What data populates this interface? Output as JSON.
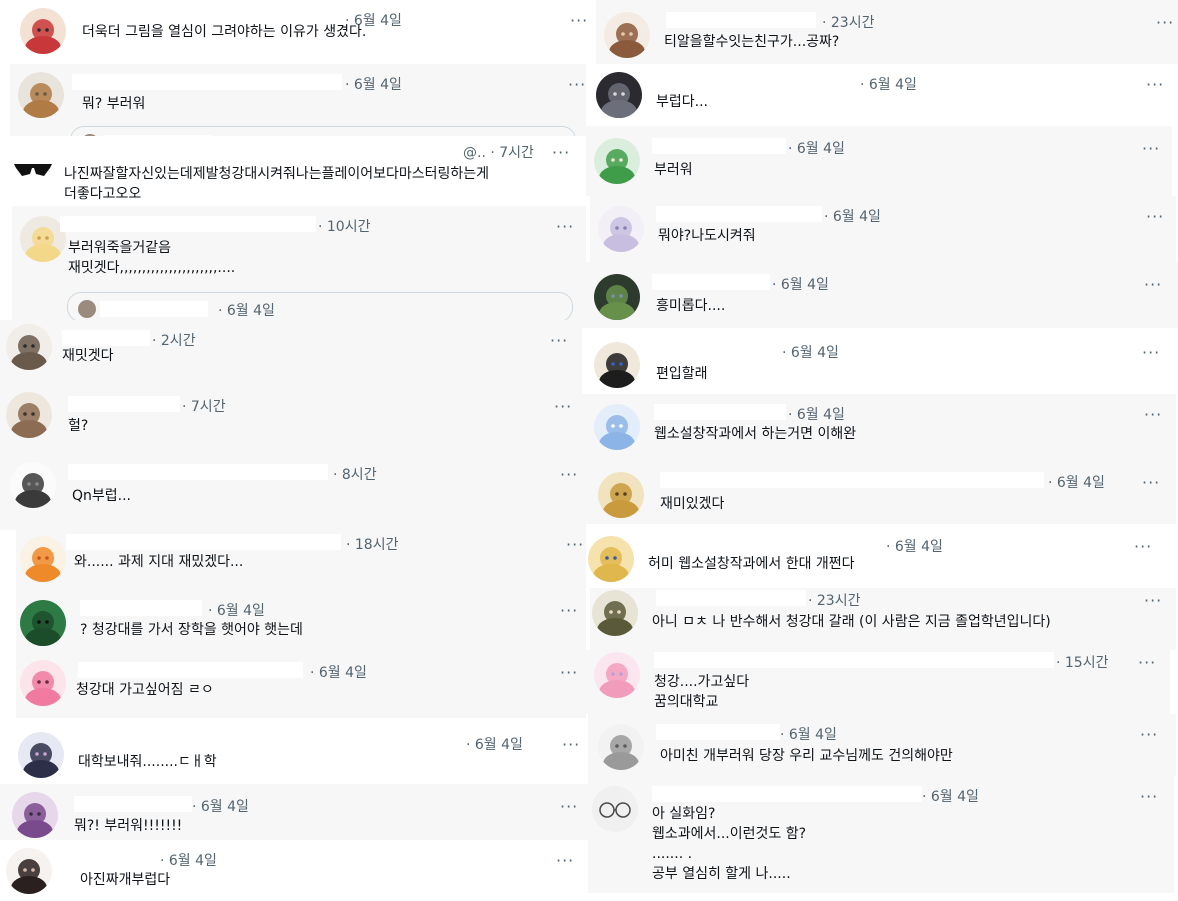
{
  "left_replies": [
    {
      "time": "· 6월 4일",
      "text": "더욱더 그림을 열심이 그려야하는 이유가 생겼다.",
      "more": "···",
      "avatar": "red-hair-avatar"
    },
    {
      "time": "· 6월 4일",
      "text": "뭐? 부러워",
      "more": "···",
      "avatar": "bread-avatar"
    },
    {
      "time": "@.. · 7시간",
      "text": "나진짜잘할자신있는데제발청강대시켜줘나는플레이어보다마스터링하는게\n더좋다고오오",
      "more": "···",
      "avatar": "sunglasses-avatar"
    },
    {
      "time": "· 10시간",
      "text": "부러워죽을거같음\n재밋겟다,,,,,,,,,,,,,,,,,,,,,,....",
      "more": "···",
      "avatar": "flower-avatar",
      "quote_time": "· 6월 4일"
    },
    {
      "time": "· 2시간",
      "text": "재밋겟다",
      "more": "···",
      "avatar": "headphones-avatar"
    },
    {
      "time": "· 7시간",
      "text": "헐?",
      "more": "···",
      "avatar": "portrait-avatar"
    },
    {
      "time": "· 8시간",
      "text": "Qn부럽...",
      "more": "···",
      "avatar": "sketch-avatar"
    },
    {
      "time": "· 18시간",
      "text": "와...... 과제 지대 재밌겠다...",
      "more": "···",
      "avatar": "orange-creature-avatar"
    },
    {
      "time": "· 6월 4일",
      "text": "? 청강대를 가서 장학을 햇어야 햇는데",
      "more": "···",
      "avatar": "green-blob-avatar"
    },
    {
      "time": "· 6월 4일",
      "text": "청강대 가고싶어짐 ㄹㅇ",
      "more": "···",
      "avatar": "pink-hair-avatar"
    },
    {
      "time": "· 6월 4일",
      "text": "대학보내줘........ㄷㅐ학",
      "more": "···",
      "avatar": "dark-hair-avatar"
    },
    {
      "time": "· 6월 4일",
      "text": "뭐?! 부러워!!!!!!!",
      "more": "···",
      "avatar": "purple-hair-avatar"
    },
    {
      "time": "· 6월 4일",
      "text": "아진짜개부럽다",
      "more": "···",
      "avatar": "long-hair-avatar"
    }
  ],
  "right_replies": [
    {
      "time": "· 23시간",
      "text": "티알을할수잇는친구가...공짜?",
      "more": "···",
      "avatar": "glasses-avatar"
    },
    {
      "time": "· 6월 4일",
      "text": "부럽다...",
      "more": "···",
      "avatar": "vr-headset-avatar"
    },
    {
      "time": "· 6월 4일",
      "text": "부러워",
      "more": "···",
      "avatar": "green-character-avatar"
    },
    {
      "time": "· 6월 4일",
      "text": "뭐야?나도시켜줘",
      "more": "···",
      "avatar": "white-hair-avatar"
    },
    {
      "time": "· 6월 4일",
      "text": "흥미롭다....",
      "more": "···",
      "avatar": "scene-avatar"
    },
    {
      "time": "· 6월 4일",
      "text": "편입할래",
      "more": "···",
      "avatar": "peace-sign-avatar"
    },
    {
      "time": "· 6월 4일",
      "text": "웹소설창작과에서 하는거면 이해완",
      "more": "···",
      "avatar": "blue-flower-avatar"
    },
    {
      "time": "· 6월 4일",
      "text": "재미있겠다",
      "more": "···",
      "avatar": "cat-avatar"
    },
    {
      "time": "· 6월 4일",
      "text": "허미 웹소설창작과에서 한대 개쩐다",
      "more": "···",
      "avatar": "blonde-avatar"
    },
    {
      "time": "· 23시간",
      "text": "아니 ㅁㅊ 나 반수해서 청강대 갈래 (이 사람은 지금 졸업학년입니다)",
      "more": "···",
      "avatar": "bob-hair-avatar"
    },
    {
      "time": "· 15시간",
      "text": "청강....가고싶다\n꿈의대학교",
      "more": "···",
      "avatar": "pink-pastel-avatar"
    },
    {
      "time": "· 6월 4일",
      "text": "아미친 개부러워 당장 우리 교수님께도 건의해야만",
      "more": "···",
      "avatar": "gray-sketch-avatar"
    },
    {
      "time": "· 6월 4일",
      "text": "아 실화임?\n웹소과에서...이런것도 함?\n....... .\n공부 열심히 할게 나.....",
      "more": "···",
      "avatar": "round-glasses-avatar"
    }
  ],
  "colors": {
    "bg": "#f7f7f8",
    "meta": "#536471",
    "text": "#0f1419"
  }
}
